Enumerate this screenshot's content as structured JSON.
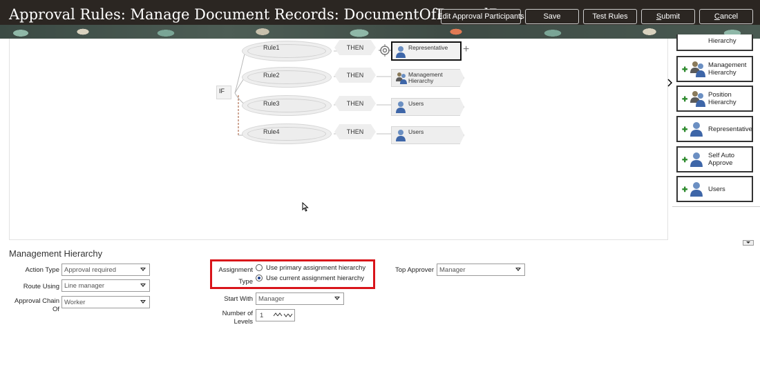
{
  "header": {
    "title": "Approval Rules: Manage Document Records: DocumentOfRecordRu...",
    "buttons": {
      "edit_participants": "Edit Approval Participants",
      "save": "Save",
      "test_rules": "Test Rules",
      "submit_u": "S",
      "submit_rest": "ubmit",
      "cancel_pre": "",
      "cancel_u": "C",
      "cancel_rest": "ancel"
    }
  },
  "rules_tree": {
    "if_label": "IF",
    "then_label": "THEN",
    "rules": [
      {
        "name": "Rule1",
        "participant": "Representative"
      },
      {
        "name": "Rule2",
        "participant": "Management Hierarchy"
      },
      {
        "name": "Rule3",
        "participant": "Users"
      },
      {
        "name": "Rule4",
        "participant": "Users"
      }
    ],
    "add_symbol": "+"
  },
  "palette": {
    "items": [
      {
        "label": "Hierarchy"
      },
      {
        "label": "Management Hierarchy"
      },
      {
        "label": "Position Hierarchy"
      },
      {
        "label": "Representative"
      },
      {
        "label": "Self Auto Approve"
      },
      {
        "label": "Users"
      }
    ]
  },
  "section": {
    "title": "Management Hierarchy"
  },
  "form": {
    "action_type": {
      "label": "Action Type",
      "value": "Approval required"
    },
    "route_using": {
      "label": "Route Using",
      "value": "Line manager"
    },
    "approval_chain_of": {
      "label": "Approval Chain Of",
      "label_line1": "Approval Chain",
      "label_line2": "Of",
      "value": "Worker"
    },
    "assignment_type": {
      "label_line1": "Assignment",
      "label_line2": "Type",
      "options": [
        {
          "label": "Use primary assignment hierarchy",
          "selected": false
        },
        {
          "label": "Use current assignment hierarchy",
          "selected": true
        }
      ]
    },
    "start_with": {
      "label": "Start With",
      "value": "Manager"
    },
    "number_of_levels": {
      "label_line1": "Number of",
      "label_line2": "Levels",
      "value": "1"
    },
    "top_approver": {
      "label": "Top Approver",
      "value": "Manager"
    }
  },
  "colors": {
    "header_bg": "#2b2622",
    "highlight_border": "#d9141a",
    "add_green": "#2d8a2d"
  }
}
